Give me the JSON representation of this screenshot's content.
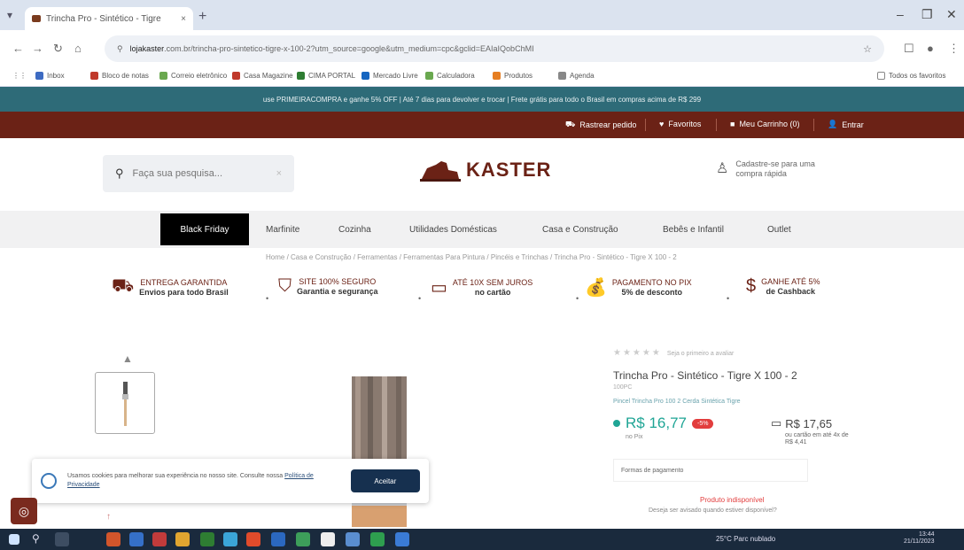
{
  "browser": {
    "tab_title": "Trincha Pro - Sintético - Tigre",
    "tab_close": "×",
    "new_tab": "+",
    "url_domain": "lojakaster",
    "url_path": ".com.br/trincha-pro-sintetico-tigre-x-100-2?utm_source=google&utm_medium=cpc&gclid=EAIaIQobChMI",
    "bookmarks": [
      "Inbox",
      "Bloco de notas",
      "Correio eletrônico",
      "Casa Magazine",
      "CIMA PORTAL",
      "Mercado Livre",
      "Calculadora",
      "Produtos",
      "Agenda",
      "Todos os favoritos"
    ],
    "bookmark_colors": [
      "#3d6bc2",
      "#c0392b",
      "#6aa84f",
      "#c0392b",
      "#2e7d32",
      "#1565c0",
      "#6aa84f",
      "#e67e22",
      "#888"
    ]
  },
  "site": {
    "promo_text": "use PRIMEIRACOMPRA e ganhe 5% OFF | Até 7 dias para devolver e trocar | Frete grátis para todo o Brasil em compras acima de R$ 299",
    "topnav": {
      "track": "Rastrear pedido",
      "favorites": "Favoritos",
      "cart": "Meu Carrinho (0)",
      "login": "Entrar"
    },
    "search_placeholder": "Faça sua pesquisa...",
    "logo_text": "KASTER",
    "account_text": "Cadastre-se para uma compra rápida",
    "categories": {
      "black_friday": "Black Friday",
      "items": [
        "Marfinite",
        "Cozinha",
        "Utilidades Domésticas",
        "Casa e Construção",
        "Bebês e Infantil",
        "Outlet"
      ]
    },
    "breadcrumb": "Home / Casa e Construção / Ferramentas / Ferramentas Para Pintura / Pincéis e Trinchas / Trincha Pro - Sintético - Tigre X 100 - 2",
    "features": [
      {
        "line1": "ENTREGA GARANTIDA",
        "line2": "Envios para todo Brasil"
      },
      {
        "line1": "SITE 100% SEGURO",
        "line2": "Garantia e segurança"
      },
      {
        "line1": "ATÉ 10X SEM JUROS",
        "line2": "no cartão"
      },
      {
        "line1": "PAGAMENTO NO PIX",
        "line2": "5% de desconto"
      },
      {
        "line1": "GANHE ATÉ 5%",
        "line2": "de Cashback"
      }
    ],
    "feature_sep": "•"
  },
  "product": {
    "stars": "★★★★★",
    "reviews": "Seja o primeiro a avaliar",
    "title": "Trincha Pro - Sintético - Tigre X 100 - 2",
    "sku": "100PC",
    "description": "Pincel Trincha Pro 100 2 Cerda Sintética Tigre",
    "price": "R$ 16,77",
    "discount_badge": "-5%",
    "price_label": "no Pix",
    "price_card": "R$ 17,65",
    "price_card_note": "ou cartão em até 4x de R$ 4,41",
    "pay_forms": "Formas de pagamento",
    "unavailable": "Produto indisponível",
    "notify": "Deseja ser avisado quando estiver disponível?"
  },
  "cookie": {
    "text": "Usamos cookies para melhorar sua experiência no nosso site. Consulte nossa",
    "link": "Política de Privacidade",
    "button": "Aceitar"
  },
  "taskbar": {
    "weather": "25°C Parc nublado",
    "time": "13:44",
    "date": "21/11/2023"
  }
}
